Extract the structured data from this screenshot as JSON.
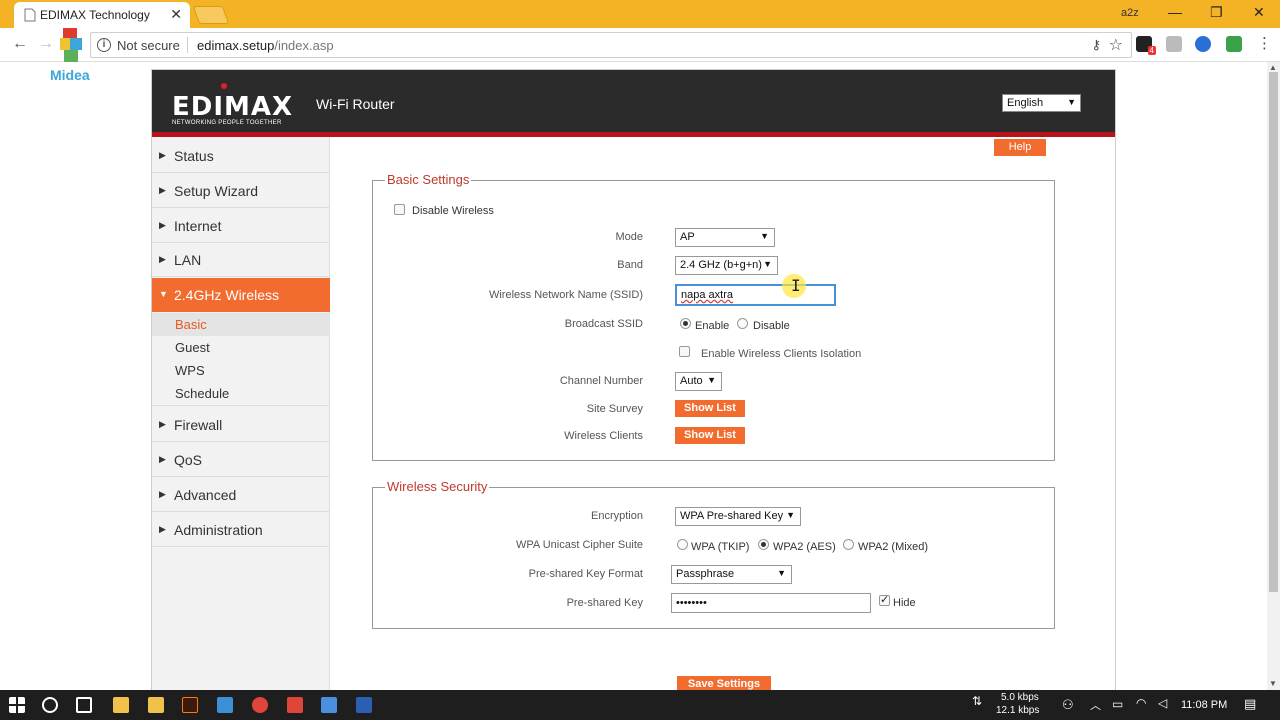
{
  "browser": {
    "tab_title": "EDIMAX Technology",
    "tab_close": "✕",
    "profile": "a2z",
    "win_minimize": "—",
    "win_restore": "❐",
    "win_close": "✕",
    "not_secure": "Not secure",
    "url_host": "edimax.setup",
    "url_path": "/index.asp",
    "ext_badge": "4"
  },
  "watermark": {
    "text": "Midea"
  },
  "router": {
    "brand": "EDIMAX",
    "tagline": "NETWORKING PEOPLE TOGETHER",
    "product": "Wi-Fi Router",
    "language": "English",
    "help": "Help"
  },
  "sidebar": {
    "items": [
      {
        "label": "Status"
      },
      {
        "label": "Setup Wizard"
      },
      {
        "label": "Internet"
      },
      {
        "label": "LAN"
      },
      {
        "label": "2.4GHz Wireless"
      },
      {
        "label": "Firewall"
      },
      {
        "label": "QoS"
      },
      {
        "label": "Advanced"
      },
      {
        "label": "Administration"
      }
    ],
    "subitems": [
      {
        "label": "Basic"
      },
      {
        "label": "Guest"
      },
      {
        "label": "WPS"
      },
      {
        "label": "Schedule"
      }
    ]
  },
  "basic": {
    "legend": "Basic Settings",
    "disable_wireless": "Disable  Wireless",
    "mode_label": "Mode",
    "mode_value": "AP",
    "band_label": "Band",
    "band_value": "2.4 GHz (b+g+n)",
    "ssid_label": "Wireless Network Name  (SSID)",
    "ssid_value": "napa axtra",
    "broadcast_label": "Broadcast SSID",
    "enable": "Enable",
    "disable": "Disable",
    "isolation": "Enable Wireless Clients Isolation",
    "channel_label": "Channel Number",
    "channel_value": "Auto",
    "site_survey_label": "Site Survey",
    "clients_label": "Wireless Clients",
    "show_list": "Show List"
  },
  "security": {
    "legend": "Wireless  Security",
    "encryption_label": "Encryption",
    "encryption_value": "WPA Pre-shared Key",
    "cipher_label": "WPA Unicast Cipher Suite",
    "cipher_tkip": "WPA (TKIP)",
    "cipher_aes": "WPA2 (AES)",
    "cipher_mixed": "WPA2 (Mixed)",
    "format_label": "Pre-shared Key Format",
    "format_value": "Passphrase",
    "key_label": "Pre-shared Key",
    "key_value": "••••••••",
    "hide": "Hide"
  },
  "save": "Save Settings",
  "taskbar": {
    "upload_speed": "5.0 kbps",
    "download_speed": "12.1 kbps",
    "time": "11:08 PM"
  }
}
